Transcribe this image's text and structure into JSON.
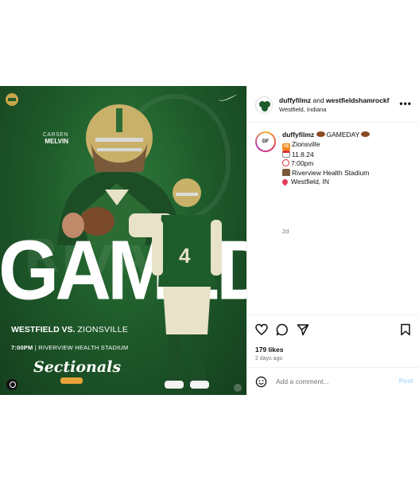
{
  "post_image": {
    "background_word": "RIVALS",
    "player_first_name": "CARSEN",
    "player_last_name": "MELVIN",
    "headline": "GAMEDAY",
    "matchup_home": "WESTFIELD VS.",
    "matchup_away": "ZIONSVILLE",
    "time": "7:00PM",
    "venue": "| RIVERVIEW HEALTH STADIUM",
    "event_logo_text": "Sectionals",
    "brand_color": "#1f5c2b"
  },
  "header": {
    "user_primary": "duffyfilmz",
    "joiner": " and ",
    "user_secondary": "westfieldshamrockf",
    "location": "Westfield, Indiana",
    "more_label": "•••"
  },
  "caption": {
    "avatar_text": "DF",
    "username": "duffyfilmz",
    "headline": "GAMEDAY",
    "lines": [
      {
        "icon": "vs-emoji",
        "text": "Zionsville"
      },
      {
        "icon": "calendar-emoji",
        "text": "11.8.24"
      },
      {
        "icon": "clock-emoji",
        "text": "7:00pm"
      },
      {
        "icon": "stadium-emoji",
        "text": "Riverview Health Stadium"
      },
      {
        "icon": "pin-emoji",
        "text": "Westfield, IN"
      }
    ],
    "time_ago": "2d"
  },
  "actions": {
    "likes": "179 likes",
    "posted": "2 days ago",
    "icons": [
      "heart-icon",
      "comment-icon",
      "share-icon",
      "bookmark-icon"
    ]
  },
  "comment": {
    "placeholder": "Add a comment...",
    "post_label": "Post"
  },
  "colors": {
    "link_disabled": "#b3dbff",
    "muted": "#737373",
    "divider": "#efefef"
  }
}
